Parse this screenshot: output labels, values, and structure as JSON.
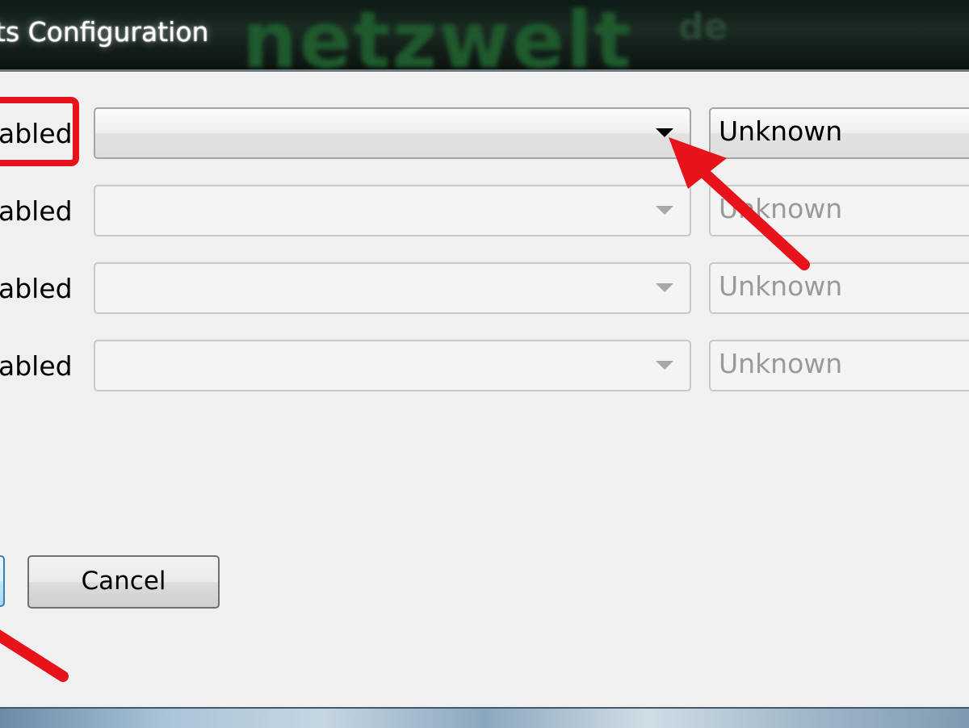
{
  "window": {
    "title": "ts Configuration",
    "watermark": "netzwelt",
    "watermark_suffix": "de"
  },
  "rows": [
    {
      "label": "abled",
      "selection": "",
      "status": "Unknown",
      "enabled": true
    },
    {
      "label": "abled",
      "selection": "",
      "status": "Unknown",
      "enabled": false
    },
    {
      "label": "abled",
      "selection": "",
      "status": "Unknown",
      "enabled": false
    },
    {
      "label": "abled",
      "selection": "",
      "status": "Unknown",
      "enabled": false
    }
  ],
  "buttons": {
    "ok_label": "",
    "cancel_label": "Cancel"
  },
  "annotations": {
    "highlight_color": "#e8121b",
    "arrow_color": "#e8121b"
  },
  "icons": {
    "dropdown": "chevron-down-icon"
  }
}
